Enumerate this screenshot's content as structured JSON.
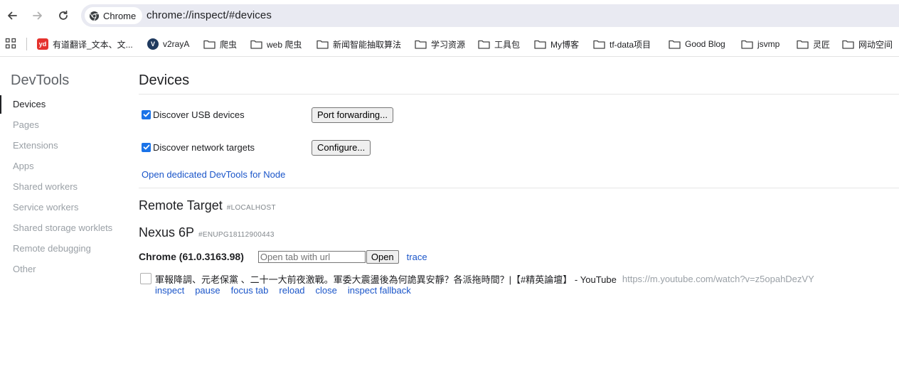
{
  "browser": {
    "chip_label": "Chrome",
    "address": "chrome://inspect/#devices"
  },
  "bookmarks": [
    {
      "label": "有道翻译_文本、文...",
      "icon": "youdao-icon"
    },
    {
      "label": "v2rayA",
      "icon": "v2raya-icon"
    },
    {
      "label": "爬虫",
      "icon": "folder-icon"
    },
    {
      "label": "web 爬虫",
      "icon": "folder-icon"
    },
    {
      "label": "新闻智能抽取算法",
      "icon": "folder-icon"
    },
    {
      "label": "学习资源",
      "icon": "folder-icon"
    },
    {
      "label": "工具包",
      "icon": "folder-icon"
    },
    {
      "label": "My博客",
      "icon": "folder-icon"
    },
    {
      "label": "tf-data项目",
      "icon": "folder-icon"
    },
    {
      "label": "Good Blog",
      "icon": "folder-icon"
    },
    {
      "label": "jsvmp",
      "icon": "folder-icon"
    },
    {
      "label": "灵匠",
      "icon": "folder-icon"
    },
    {
      "label": "网动空间",
      "icon": "folder-icon"
    }
  ],
  "sidebar": {
    "title": "DevTools",
    "items": [
      {
        "label": "Devices",
        "active": true
      },
      {
        "label": "Pages"
      },
      {
        "label": "Extensions"
      },
      {
        "label": "Apps"
      },
      {
        "label": "Shared workers"
      },
      {
        "label": "Service workers"
      },
      {
        "label": "Shared storage worklets"
      },
      {
        "label": "Remote debugging"
      },
      {
        "label": "Other"
      }
    ]
  },
  "main": {
    "title": "Devices",
    "discover_usb": {
      "label": "Discover USB devices",
      "checked": true,
      "button": "Port forwarding..."
    },
    "discover_network": {
      "label": "Discover network targets",
      "checked": true,
      "button": "Configure..."
    },
    "node_link": "Open dedicated DevTools for Node",
    "remote_target": {
      "title": "Remote Target",
      "tag": "#LOCALHOST"
    },
    "device": {
      "name": "Nexus 6P",
      "serial": "#ENUPG18112900443"
    },
    "browser_entry": {
      "name": "Chrome (61.0.3163.98)",
      "url_placeholder": "Open tab with url",
      "open_button": "Open",
      "trace_link": "trace"
    },
    "target": {
      "title": "軍報降調、元老保黨 、二十一大前夜激戰。軍委大震盪後為何詭異安靜？各派拖時間？|【#精英論壇】 - YouTube",
      "url": "https://m.youtube.com/watch?v=z5opahDezVY",
      "actions": [
        "inspect",
        "pause",
        "focus tab",
        "reload",
        "close",
        "inspect fallback"
      ]
    }
  }
}
